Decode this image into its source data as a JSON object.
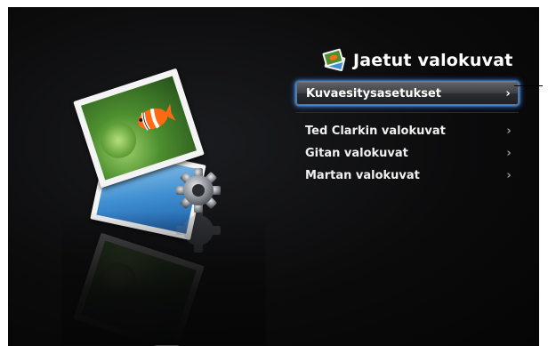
{
  "header": {
    "title": "Jaetut valokuvat",
    "icon": "photos-stack-icon"
  },
  "menu": {
    "selected": {
      "label": "Kuvaesitysasetukset",
      "chevron": "›"
    },
    "items": [
      {
        "label": "Ted Clarkin valokuvat",
        "chevron": "›"
      },
      {
        "label": "Gitan valokuvat",
        "chevron": "›"
      },
      {
        "label": "Martan valokuvat",
        "chevron": "›"
      }
    ]
  },
  "artwork": {
    "description_icon": "photo-settings-artwork",
    "selection_glow_color": "#3c8cff",
    "background_color": "#0b0b0c"
  }
}
